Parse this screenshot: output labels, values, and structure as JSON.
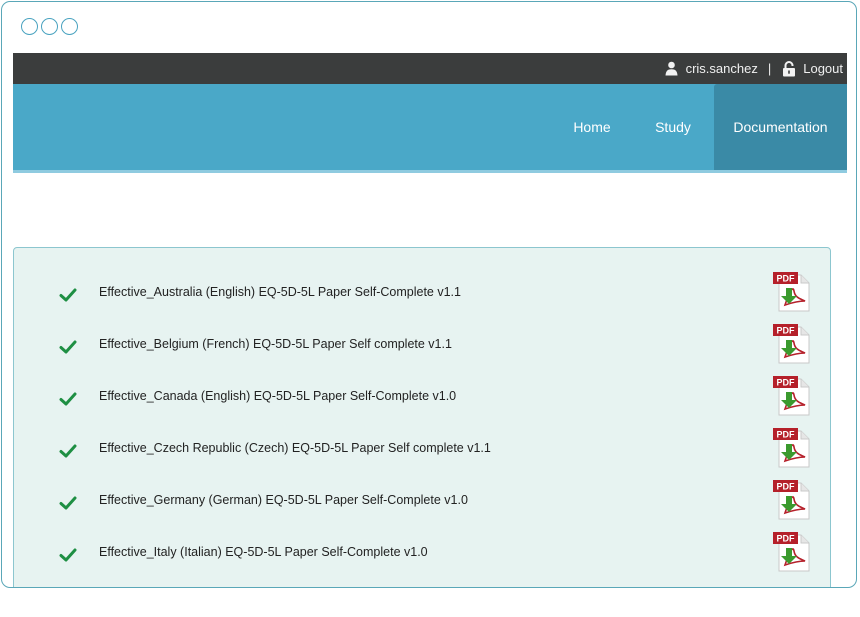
{
  "window": {
    "controls": [
      "circle",
      "circle",
      "circle"
    ]
  },
  "topbar": {
    "username": "cris.sanchez",
    "separator": "|",
    "logout_label": "Logout",
    "icons": {
      "user": "user-icon",
      "lock": "lock-icon"
    }
  },
  "nav": {
    "items": [
      {
        "label": "Home"
      },
      {
        "label": "Study"
      },
      {
        "label": "Documentation",
        "active": true
      }
    ]
  },
  "documents": [
    {
      "name": "Effective_Australia (English) EQ-5D-5L Paper Self-Complete v1.1",
      "status": "check-icon",
      "icon": "pdf-download-icon"
    },
    {
      "name": "Effective_Belgium (French) EQ-5D-5L Paper Self complete v1.1",
      "status": "check-icon",
      "icon": "pdf-download-icon"
    },
    {
      "name": "Effective_Canada (English) EQ-5D-5L Paper Self-Complete v1.0",
      "status": "check-icon",
      "icon": "pdf-download-icon"
    },
    {
      "name": "Effective_Czech Republic (Czech) EQ-5D-5L Paper Self complete v1.1",
      "status": "check-icon",
      "icon": "pdf-download-icon"
    },
    {
      "name": "Effective_Germany (German) EQ-5D-5L Paper Self-Complete v1.0",
      "status": "check-icon",
      "icon": "pdf-download-icon"
    },
    {
      "name": "Effective_Italy (Italian) EQ-5D-5L Paper Self-Complete v1.0",
      "status": "check-icon",
      "icon": "pdf-download-icon"
    }
  ],
  "pdf_badge": "PDF",
  "colors": {
    "topbar": "#3b3d3d",
    "nav": "#4aa8c8",
    "nav_active": "#3a8aa6",
    "panel": "#e7f3f1",
    "check": "#1e8f43",
    "pdf_red": "#b5202a",
    "pdf_arrow": "#3b9a2e"
  }
}
